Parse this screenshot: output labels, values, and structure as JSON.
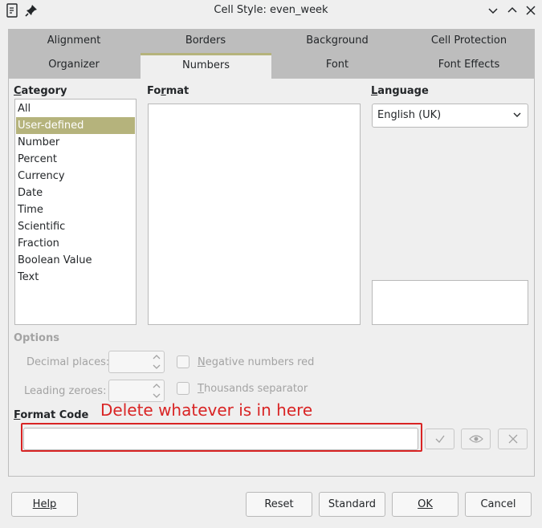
{
  "window": {
    "title": "Cell Style: even_week"
  },
  "tabs": {
    "row1": [
      "Alignment",
      "Borders",
      "Background",
      "Cell Protection"
    ],
    "row2": [
      "Organizer",
      "Numbers",
      "Font",
      "Font Effects"
    ],
    "active": "Numbers"
  },
  "category": {
    "label_first": "C",
    "label_rest": "ategory",
    "items": [
      "All",
      "User-defined",
      "Number",
      "Percent",
      "Currency",
      "Date",
      "Time",
      "Scientific",
      "Fraction",
      "Boolean Value",
      "Text"
    ],
    "selected": "User-defined"
  },
  "format": {
    "label_pre": "Fo",
    "label_u": "r",
    "label_post": "mat"
  },
  "language": {
    "label_first": "L",
    "label_rest": "anguage",
    "value": "English (UK)"
  },
  "options": {
    "title": "Options",
    "decimal_places": "Decimal places:",
    "leading_zeroes": "Leading zeroes:",
    "negative_red_first": "N",
    "negative_red_rest": "egative numbers red",
    "thousands_first": "T",
    "thousands_rest": "housands separator"
  },
  "format_code": {
    "label_first": "F",
    "label_rest": "ormat Code",
    "value": "",
    "annotation": "Delete whatever is in here"
  },
  "buttons": {
    "help": "Help",
    "reset": "Reset",
    "standard": "Standard",
    "ok": "OK",
    "cancel": "Cancel"
  },
  "colors": {
    "accent": "#b5b37c",
    "annotation_red": "#d92424"
  }
}
